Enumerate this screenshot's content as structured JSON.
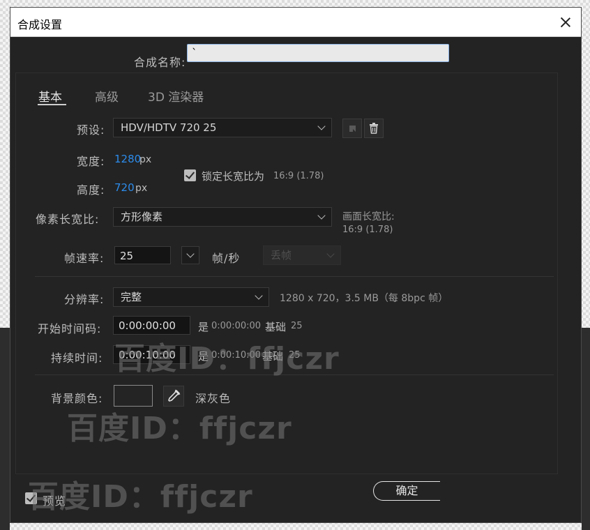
{
  "dialog": {
    "title": "合成设置",
    "name_label": "合成名称:",
    "name_value": "`",
    "tabs": [
      "基本",
      "高级",
      "3D 渲染器"
    ],
    "preset_label": "预设:",
    "preset_value": "HDV/HDTV 720 25",
    "width_label": "宽度:",
    "width_value": "1280",
    "height_label": "高度:",
    "height_value": "720",
    "unit_px": "px",
    "lock_label": "锁定长宽比为",
    "lock_ratio": "16:9 (1.78)",
    "pixel_ratio_label": "像素长宽比:",
    "pixel_ratio_value": "方形像素",
    "frame_ratio_label": "画面长宽比:",
    "frame_ratio_value": "16:9 (1.78)",
    "fps_label": "帧速率:",
    "fps_value": "25",
    "fps_unit": "帧/秒",
    "drop_frame_label": "丢帧",
    "resolution_label": "分辨率:",
    "resolution_value": "完整",
    "resolution_info": "1280 x 720，3.5 MB（每 8bpc 帧）",
    "start_label": "开始时间码:",
    "start_value": "0:00:00:00",
    "start_is_prefix": "是",
    "start_is_value": "0:00:00:00",
    "start_base_label": "基础",
    "start_base_value": "25",
    "duration_label": "持续时间:",
    "duration_value": "0:00:10:00",
    "duration_is_prefix": "是",
    "duration_is_value": "0:00:10:00",
    "duration_base_label": "基础",
    "duration_base_value": "25",
    "bg_color_label": "背景颜色:",
    "bg_color_hex": "#242424",
    "bg_color_name": "深灰色",
    "preview_label": "预览",
    "ok_label": "确定"
  },
  "watermark": "百度ID：ffjczr",
  "icons": {
    "close": "close-icon",
    "preset_save": "save-preset-icon",
    "preset_delete": "trash-icon",
    "eyedropper": "eyedropper-icon",
    "fps_dropdown": "chevron-down-icon"
  }
}
